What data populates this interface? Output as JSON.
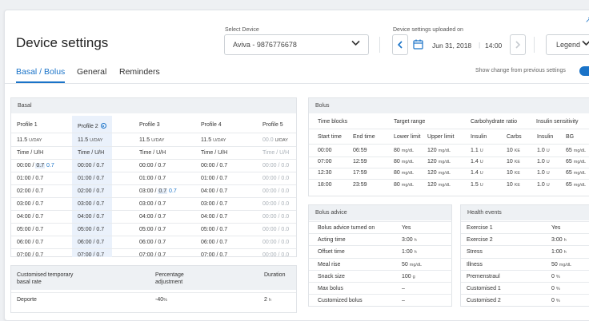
{
  "header": {
    "title": "Device settings",
    "select_label": "Select Device",
    "device": "Aviva - 9876776678",
    "upload_label": "Device settings uploaded on",
    "date": "Jun 31, 2018",
    "time": "14:00",
    "legend": "Legend",
    "corner_arrow": "↗"
  },
  "tabs": [
    "Basal / Bolus",
    "General",
    "Reminders"
  ],
  "show_change": "Show change from previous settings",
  "basal": {
    "title": "Basal",
    "profiles": [
      "Profile 1",
      "Profile 2",
      "Profile 3",
      "Profile 4",
      "Profile 5"
    ],
    "rates": [
      "11.5",
      "11.5",
      "11.5",
      "11.5",
      "00.0"
    ],
    "rate_unit": "U/DAY",
    "col_head": "Time / U/H",
    "rows": [
      [
        "00:00 / ",
        "0.7",
        "0.7",
        "00:00 / 0.7",
        "00:00 / 0.7",
        "00:00 / 0.7",
        "00:00 / 0.0"
      ],
      [
        "01:00 / 0.7",
        "01:00 / 0.7",
        "01:00 / 0.7",
        "01:00 / 0.7",
        "00:00 / 0.0"
      ],
      [
        "02:00 / 0.7",
        "02:00 / 0.7",
        "03:00 / ",
        "0.7",
        "0.7",
        "04:00 / 0.7",
        "00:00 / 0.0"
      ],
      [
        "03:00 / 0.7",
        "03:00 / 0.7",
        "03:00 / 0.7",
        "03:00 / 0.7",
        "00:00 / 0.0"
      ],
      [
        "04:00 / 0.7",
        "04:00 / 0.7",
        "04:00 / 0.7",
        "04:00 / 0.7",
        "00:00 / 0.0"
      ],
      [
        "05:00 / 0.7",
        "05:00 / 0.7",
        "05:00 / 0.7",
        "05:00 / 0.7",
        "00:00 / 0.0"
      ],
      [
        "06:00 / 0.7",
        "06:00 / 0.7",
        "06:00 / 0.7",
        "06:00 / 0.7",
        "00:00 / 0.0"
      ],
      [
        "07:00 / 0.7",
        "07:00 / 0.7",
        "07:00 / 0.7",
        "07:00 / 0.7",
        "00:00 / 0.0"
      ]
    ]
  },
  "temp": {
    "h1": "Customised temporary",
    "h1b": "basal rate",
    "h2": "Percentage",
    "h2b": "adjustment",
    "h3": "Duration",
    "name": "Deporte",
    "pct": "-40",
    "pct_unit": "%",
    "dur": "2",
    "dur_unit": "h"
  },
  "bolus": {
    "title": "Bolus",
    "groups": [
      "Time blocks",
      "Target range",
      "Carbohydrate ratio",
      "Insulin sensitivity"
    ],
    "cols": [
      "Start time",
      "End time",
      "Lower limit",
      "Upper limit",
      "Insulin",
      "Carbs",
      "Insulin",
      "BG"
    ],
    "rows": [
      [
        "00:00",
        "06:59",
        "80",
        "120",
        "1.1",
        "10",
        "1.0",
        "65"
      ],
      [
        "07:00",
        "12:59",
        "80",
        "120",
        "1.4",
        "10",
        "1.0",
        "65"
      ],
      [
        "12:30",
        "17:59",
        "80",
        "120",
        "1.4",
        "10",
        "1.0",
        "65"
      ],
      [
        "18:00",
        "23:59",
        "80",
        "120",
        "1.5",
        "10",
        "1.0",
        "65"
      ]
    ],
    "mg": "mg/dL",
    "u": "U",
    "ke": "KE"
  },
  "advice": {
    "title": "Bolus advice",
    "rows": [
      [
        "Bolus advice turned on",
        "Yes",
        ""
      ],
      [
        "Acting time",
        "3:00",
        "h"
      ],
      [
        "Offset time",
        "1:00",
        "h"
      ],
      [
        "Meal rise",
        "50",
        "mg/dL"
      ],
      [
        "Snack size",
        "100",
        "g"
      ],
      [
        "Max bolus",
        "–",
        ""
      ],
      [
        "Customized bolus",
        "–",
        ""
      ]
    ]
  },
  "health": {
    "title": "Health events",
    "rows": [
      [
        "Exercise 1",
        "Yes",
        ""
      ],
      [
        "Exercise 2",
        "3:00",
        "h"
      ],
      [
        "Stress",
        "1:00",
        "h"
      ],
      [
        "Illness",
        "50",
        "mg/dL"
      ],
      [
        "Premenstraul",
        "0",
        "%"
      ],
      [
        "Customised 1",
        "0",
        "%"
      ],
      [
        "Customised 2",
        "0",
        "%"
      ]
    ]
  },
  "colors": {
    "accent": "#1a73c8",
    "header_bg": "#eef1f4",
    "highlight": "#eaf1fb"
  }
}
